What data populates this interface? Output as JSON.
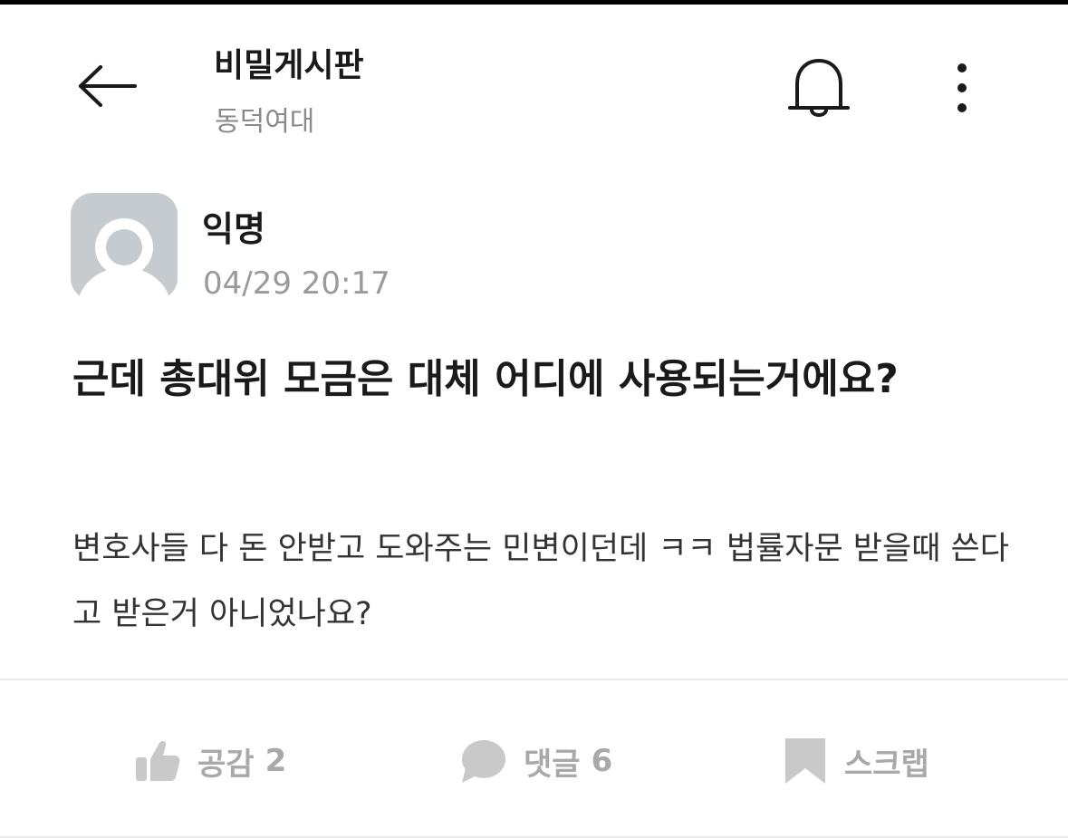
{
  "header": {
    "board_title": "비밀게시판",
    "board_subtitle": "동덕여대",
    "back_icon": "arrow-left-icon",
    "bell_icon": "bell-icon",
    "more_icon": "more-vertical-icon"
  },
  "post": {
    "author": "익명",
    "date": "04/29 20:17",
    "title": "근데 총대위 모금은 대체 어디에 사용되는거에요?",
    "body": "변호사들 다 돈 안받고 도와주는 민변이던데 ㅋㅋ 법률자문 받을때 쓴다고 받은거 아니었나요?"
  },
  "actions": {
    "like": {
      "label": "공감",
      "count": "2",
      "icon": "thumbs-up-icon"
    },
    "comment": {
      "label": "댓글",
      "count": "6",
      "icon": "comment-bubble-icon"
    },
    "scrap": {
      "label": "스크랩",
      "icon": "bookmark-icon"
    }
  },
  "colors": {
    "text_primary": "#1a1a1a",
    "text_secondary": "#8a8a8a",
    "action_gray": "#a9a9a9",
    "avatar_bg": "#c5cbcf"
  }
}
